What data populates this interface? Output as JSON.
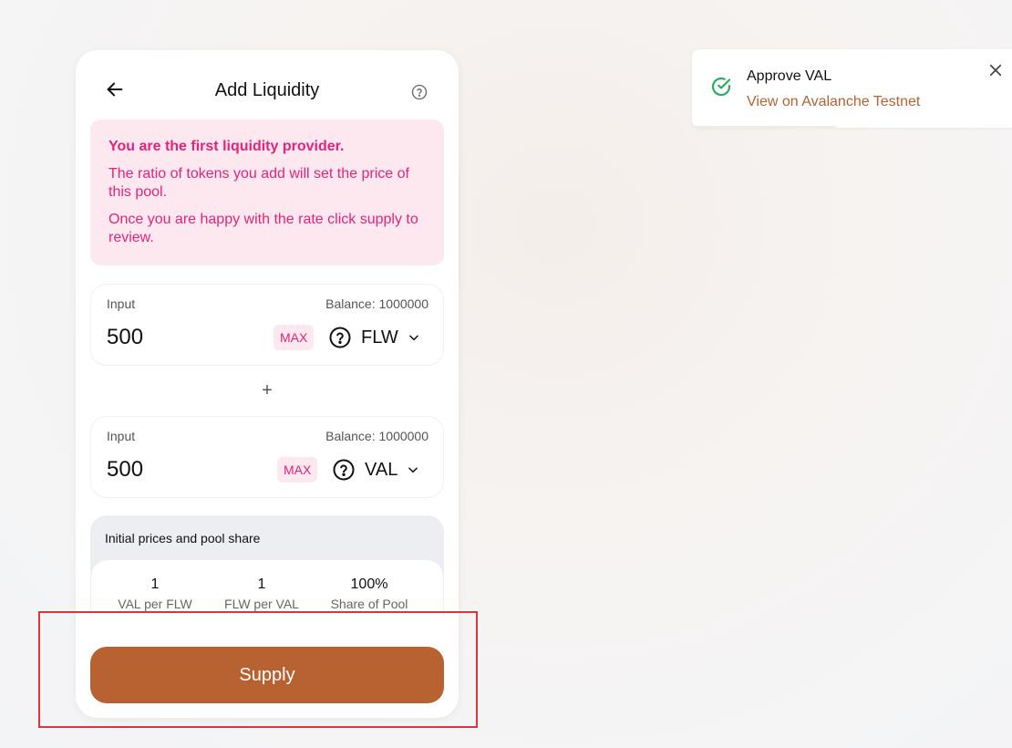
{
  "card": {
    "title": "Add Liquidity",
    "notice": {
      "title": "You are the first liquidity provider.",
      "p1": "The ratio of tokens you add will set the price of this pool.",
      "p2": "Once you are happy with the rate click supply to review."
    },
    "input_a": {
      "label": "Input",
      "balance": "Balance: 1000000",
      "value": "500",
      "max": "MAX",
      "token": "FLW"
    },
    "plus": "+",
    "input_b": {
      "label": "Input",
      "balance": "Balance: 1000000",
      "value": "500",
      "max": "MAX",
      "token": "VAL"
    },
    "prices": {
      "title": "Initial prices and pool share",
      "items": [
        {
          "value": "1",
          "label": "VAL per FLW"
        },
        {
          "value": "1",
          "label": "FLW per VAL"
        },
        {
          "value": "100%",
          "label": "Share of Pool"
        }
      ]
    },
    "supply_label": "Supply"
  },
  "toast": {
    "title": "Approve VAL",
    "link": "View on Avalanche Testnet"
  },
  "colors": {
    "accent": "#b86232",
    "pink": "#e4237a",
    "pink_bg": "#fde8ef",
    "success": "#27ae60",
    "highlight": "#e0343c"
  },
  "icons": {
    "back": "arrow-left-icon",
    "help": "question-circle-icon",
    "token": "question-circle-icon",
    "chevron": "chevron-down-icon",
    "success": "check-circle-icon",
    "close": "close-icon"
  }
}
